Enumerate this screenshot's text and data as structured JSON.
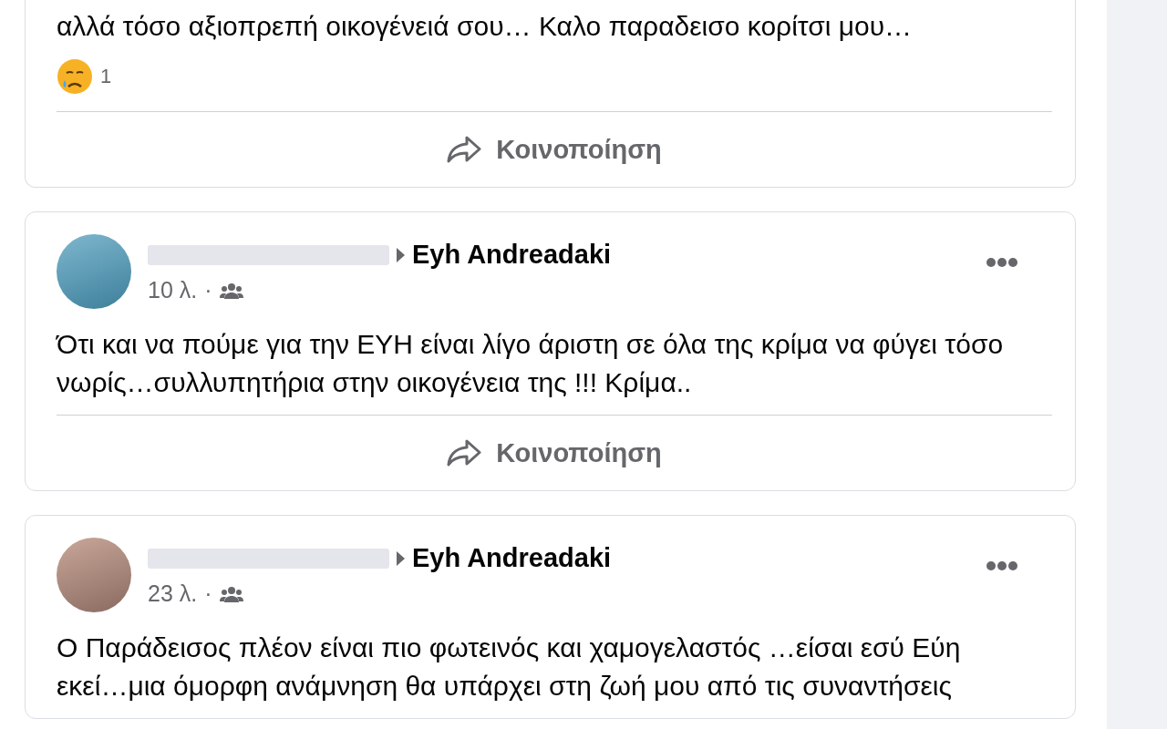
{
  "posts": [
    {
      "text": "αλλά τόσο αξιοπρεπή οικογένειά σου… Καλο παραδεισο κορίτσι μου…",
      "reaction_count": "1",
      "share_label": "Κοινοποίηση"
    },
    {
      "author": {
        "target": "Eyh Andreadaki",
        "time": "10 λ.",
        "separator": "·"
      },
      "text": "Ότι και να πούμε για την ΕΥΗ είναι λίγο άριστη σε όλα της κρίμα να φύγει τόσο νωρίς…συλλυπητήρια στην οικογένεια της !!! Κρίμα..",
      "share_label": "Κοινοποίηση"
    },
    {
      "author": {
        "target": "Eyh Andreadaki",
        "time": "23 λ.",
        "separator": "·"
      },
      "text": "Ο Παράδεισος πλέον είναι πιο φωτεινός και χαμογελαστός …είσαι εσύ Εύη εκεί…μια όμορφη ανάμνηση θα υπάρχει στη ζωή μου από τις συναντήσεις"
    }
  ]
}
